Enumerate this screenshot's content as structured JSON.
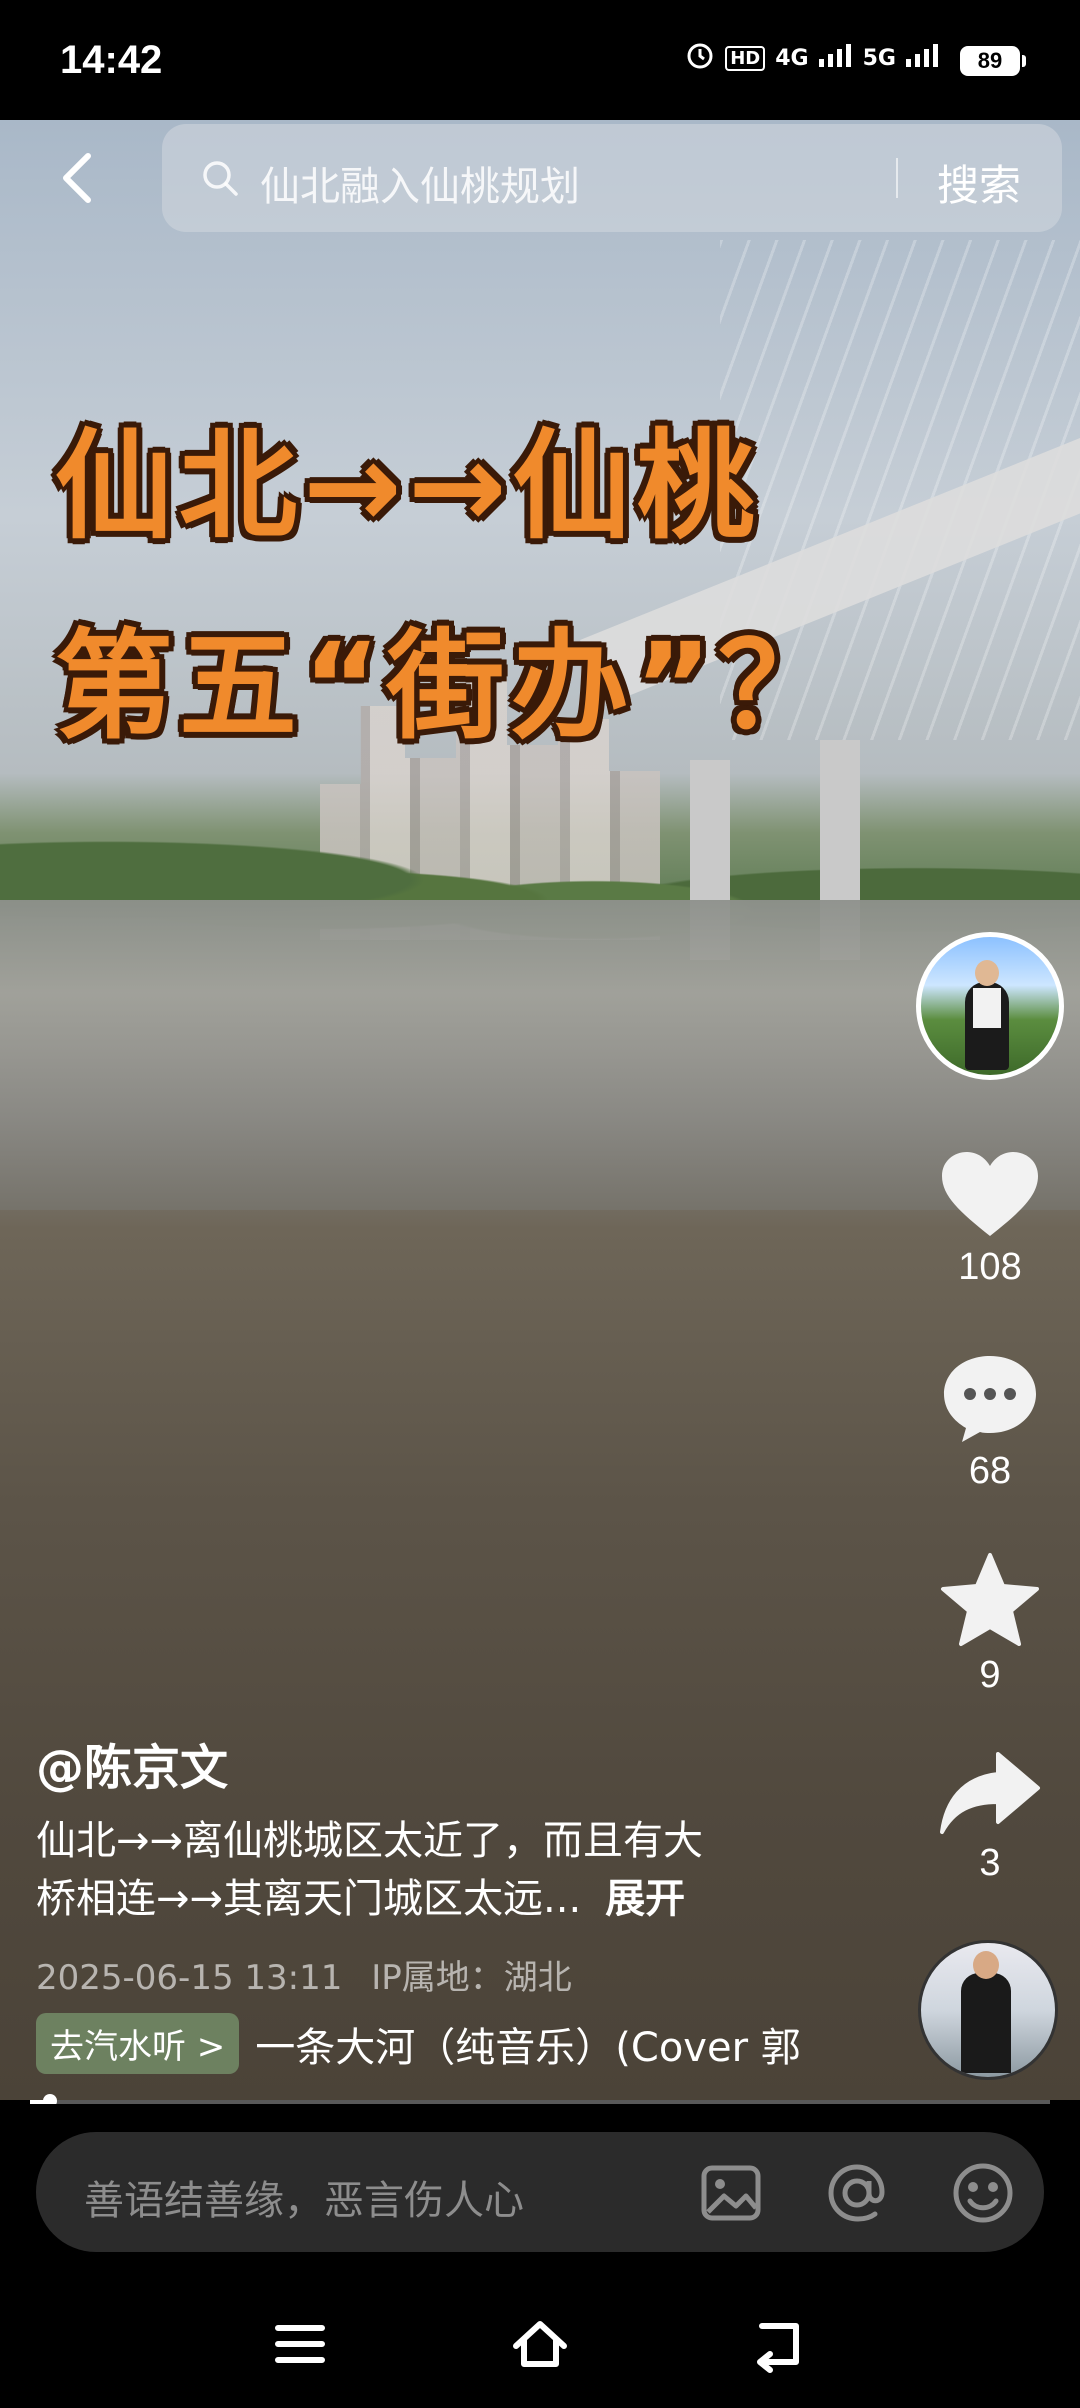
{
  "status_bar": {
    "time": "14:42",
    "icons": [
      "alarm-icon",
      "hd-icon",
      "4g-signal-icon",
      "5g-signal-icon"
    ],
    "network_labels": [
      "HD",
      "4G",
      "5G"
    ],
    "battery": "89"
  },
  "search": {
    "placeholder": "仙北融入仙桃规划",
    "button_label": "搜索"
  },
  "video": {
    "overlay_line1": "仙北→→仙桃",
    "overlay_line2": "第五“街办”？",
    "progress_fraction": 0.02
  },
  "actions": {
    "likes": "108",
    "comments": "68",
    "favorites": "9",
    "shares": "3"
  },
  "post": {
    "author": "@陈京文",
    "description_line1": "仙北→→离仙桃城区太近了，而且有大",
    "description_line2": "桥相连→→其离天门城区太远...",
    "expand_label": "展开",
    "timestamp": "2025-06-15 13:11",
    "ip_location": "IP属地：湖北",
    "music_tag": "去汽水听 >",
    "music_title": "一条大河（纯音乐）(Cover 郭"
  },
  "comment_input": {
    "placeholder": "善语结善缘，恶言伤人心"
  },
  "colors": {
    "overlay_text": "#f08a2c",
    "comment_bar": "#2b2b2b"
  }
}
